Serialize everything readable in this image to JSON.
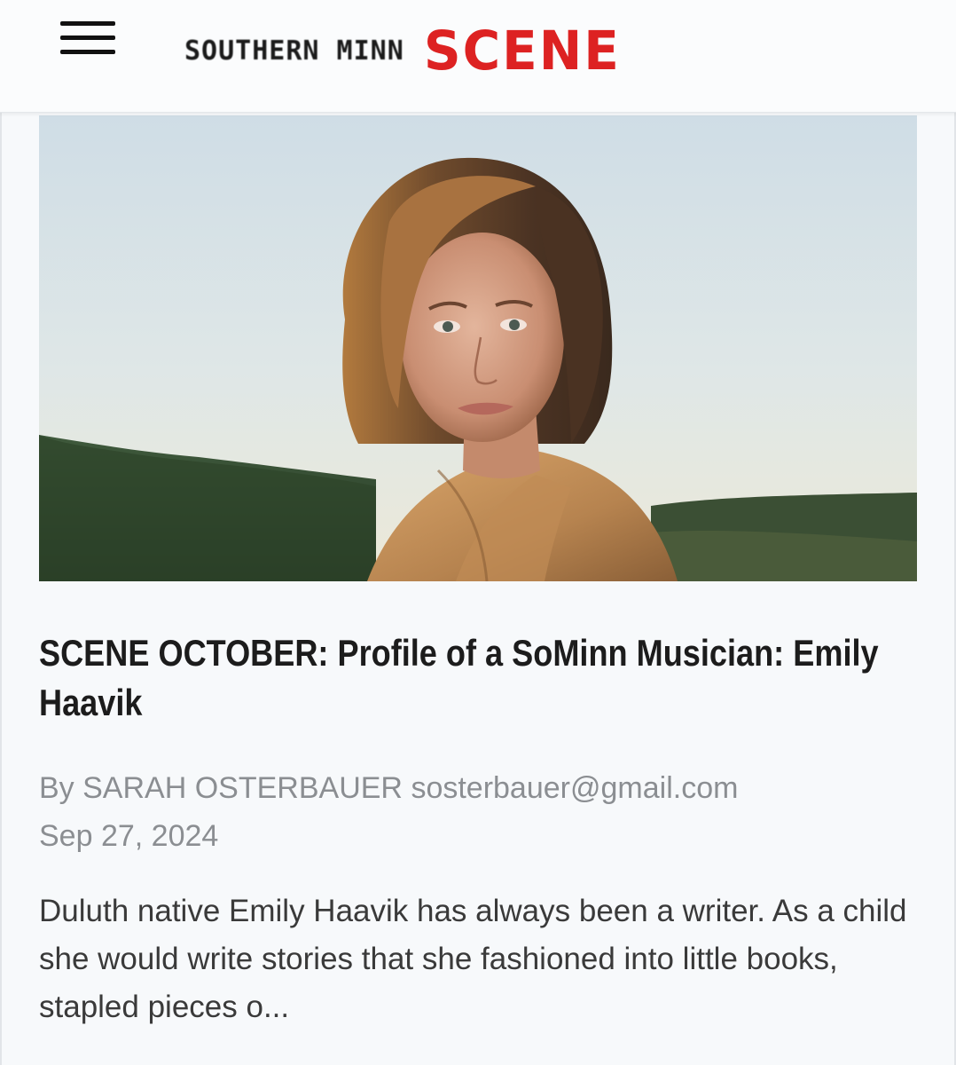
{
  "header": {
    "menu_icon": "hamburger-menu-icon",
    "logo": {
      "sub": "SOUTHERN MINN",
      "main": "SCENE",
      "main_color": "#dd2222"
    }
  },
  "article": {
    "title": "SCENE OCTOBER: Profile of a SoMinn Musician: Emily Haavik",
    "byline_prefix": "By SARAH OSTERBAUER",
    "author_email": "sosterbauer@gmail.com",
    "date": "Sep 27, 2024",
    "excerpt": "Duluth native Emily Haavik has always been a writer. As a child she would write stories that she fashioned into little books, stapled pieces o..."
  }
}
